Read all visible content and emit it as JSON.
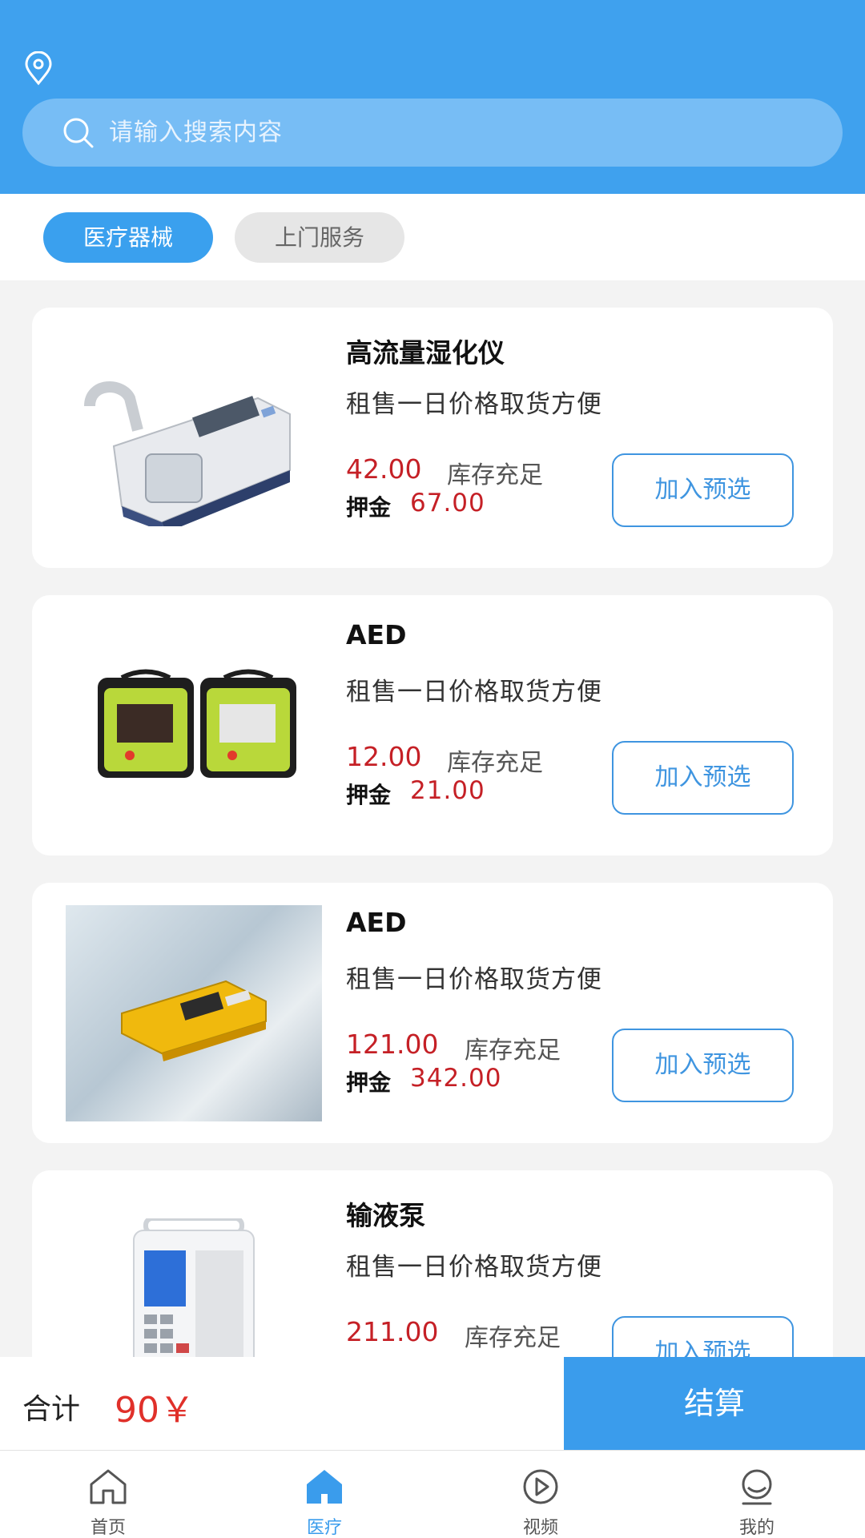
{
  "header": {
    "location_icon": "location-pin-icon",
    "search": {
      "icon": "search-icon",
      "placeholder": "请输入搜索内容"
    }
  },
  "tabs": [
    {
      "label": "医疗器械",
      "active": true
    },
    {
      "label": "上门服务",
      "active": false
    }
  ],
  "products": [
    {
      "title": "高流量湿化仪",
      "desc": "租售一日价格取货方便",
      "price": "42.00",
      "stock": "库存充足",
      "deposit_label": "押金",
      "deposit": "67.00",
      "button": "加入预选",
      "image": "humidifier-device-image"
    },
    {
      "title": "AED",
      "desc": "租售一日价格取货方便",
      "price": "12.00",
      "stock": "库存充足",
      "deposit_label": "押金",
      "deposit": "21.00",
      "button": "加入预选",
      "image": "aed-pair-image"
    },
    {
      "title": "AED",
      "desc": "租售一日价格取货方便",
      "price": "121.00",
      "stock": "库存充足",
      "deposit_label": "押金",
      "deposit": "342.00",
      "button": "加入预选",
      "image": "aed-yellow-image"
    },
    {
      "title": "输液泵",
      "desc": "租售一日价格取货方便",
      "price": "211.00",
      "stock": "库存充足",
      "deposit_label": "押金",
      "deposit": "",
      "button": "加入预选",
      "image": "infusion-pump-image"
    }
  ],
  "checkout": {
    "total_label": "合计",
    "total_value": "90￥",
    "button": "结算"
  },
  "nav": [
    {
      "label": "首页",
      "icon": "home-outline-icon",
      "active": false
    },
    {
      "label": "医疗",
      "icon": "home-filled-icon",
      "active": true
    },
    {
      "label": "视频",
      "icon": "play-circle-icon",
      "active": false
    },
    {
      "label": "我的",
      "icon": "user-profile-icon",
      "active": false
    }
  ],
  "colors": {
    "header_bg": "#3fa1ee",
    "accent": "#3a9cec",
    "price_red": "#c52026",
    "total_red": "#e0302a"
  }
}
